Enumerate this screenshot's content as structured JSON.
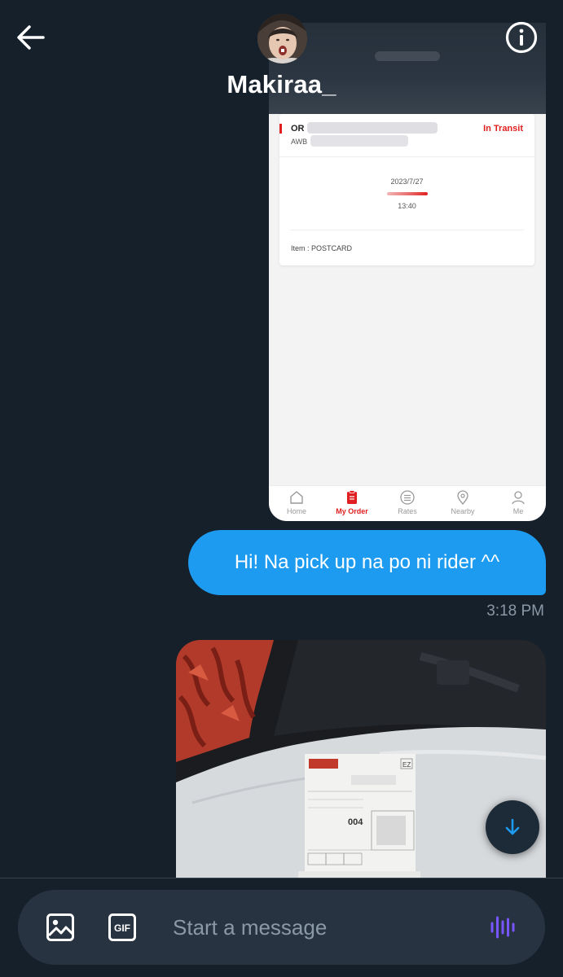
{
  "header": {
    "username": "Makiraa_",
    "back_icon": "arrow-left-icon",
    "info_icon": "info-icon"
  },
  "messages": {
    "screenshot": {
      "card": {
        "id_prefix": "OR",
        "awb_prefix": "AWB",
        "status": "In Transit",
        "date": "2023/7/27",
        "time": "13:40",
        "item": "Item : POSTCARD"
      },
      "nav": [
        {
          "label": "Home",
          "icon": "home-icon"
        },
        {
          "label": "My Order",
          "icon": "clipboard-icon"
        },
        {
          "label": "Rates",
          "icon": "list-icon"
        },
        {
          "label": "Nearby",
          "icon": "location-pin-icon"
        },
        {
          "label": "Me",
          "icon": "person-icon"
        }
      ]
    },
    "text_bubble": {
      "text": "Hi! Na pick up na po ni rider ^^",
      "time": "3:18 PM"
    },
    "photo": {
      "label_visible": "EZ",
      "waybill_code": "004"
    }
  },
  "composer": {
    "placeholder": "Start a message",
    "image_icon": "image-icon",
    "gif_label": "GIF",
    "voice_icon": "voice-wave-icon"
  },
  "colors": {
    "background": "#15202b",
    "bubble": "#1d9bf0",
    "composer": "#273340",
    "voice_accent": "#7856ff",
    "status_red": "#e02020"
  }
}
